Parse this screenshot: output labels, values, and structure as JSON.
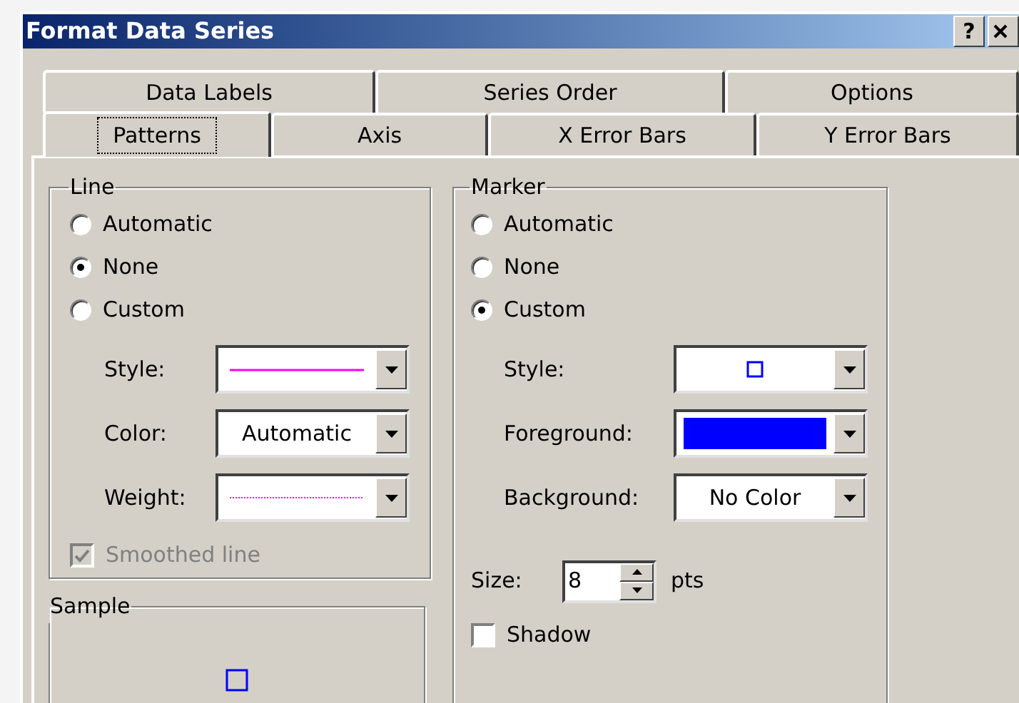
{
  "window": {
    "title": "Format Data Series",
    "help_button": "?"
  },
  "tab_rows": [
    [
      {
        "label": "Data Labels",
        "selected": false
      },
      {
        "label": "Series Order",
        "selected": false
      },
      {
        "label": "Options",
        "selected": false
      }
    ],
    [
      {
        "label": "Patterns",
        "selected": true
      },
      {
        "label": "Axis",
        "selected": false
      },
      {
        "label": "X Error Bars",
        "selected": false
      },
      {
        "label": "Y Error Bars",
        "selected": false
      }
    ]
  ],
  "line": {
    "title": "Line",
    "options": [
      {
        "label": "Automatic",
        "selected": false
      },
      {
        "label": "None",
        "selected": true
      },
      {
        "label": "Custom",
        "selected": false
      }
    ],
    "fields": [
      {
        "label": "Style:",
        "kind": "line",
        "color": "#ff00ff"
      },
      {
        "label": "Color:",
        "kind": "text",
        "value": "Automatic"
      },
      {
        "label": "Weight:",
        "kind": "dotted",
        "color": "#ff00ff"
      }
    ],
    "smoothed": {
      "label": "Smoothed line",
      "checked": true,
      "disabled": true
    }
  },
  "sample": {
    "title": "Sample",
    "kind": "marker",
    "color": "#0000ff"
  },
  "marker": {
    "title": "Marker",
    "options": [
      {
        "label": "Automatic",
        "selected": false
      },
      {
        "label": "None",
        "selected": false
      },
      {
        "label": "Custom",
        "selected": true
      }
    ],
    "fields": [
      {
        "label": "Style:",
        "kind": "marker",
        "color": "#0000ff"
      },
      {
        "label": "Foreground:",
        "kind": "swatch",
        "color": "#0000ff"
      },
      {
        "label": "Background:",
        "kind": "text",
        "value": "No Color"
      }
    ],
    "size": {
      "label": "Size:",
      "value": "8",
      "unit": "pts"
    },
    "shadow": {
      "label": "Shadow",
      "checked": false,
      "disabled": false
    }
  }
}
